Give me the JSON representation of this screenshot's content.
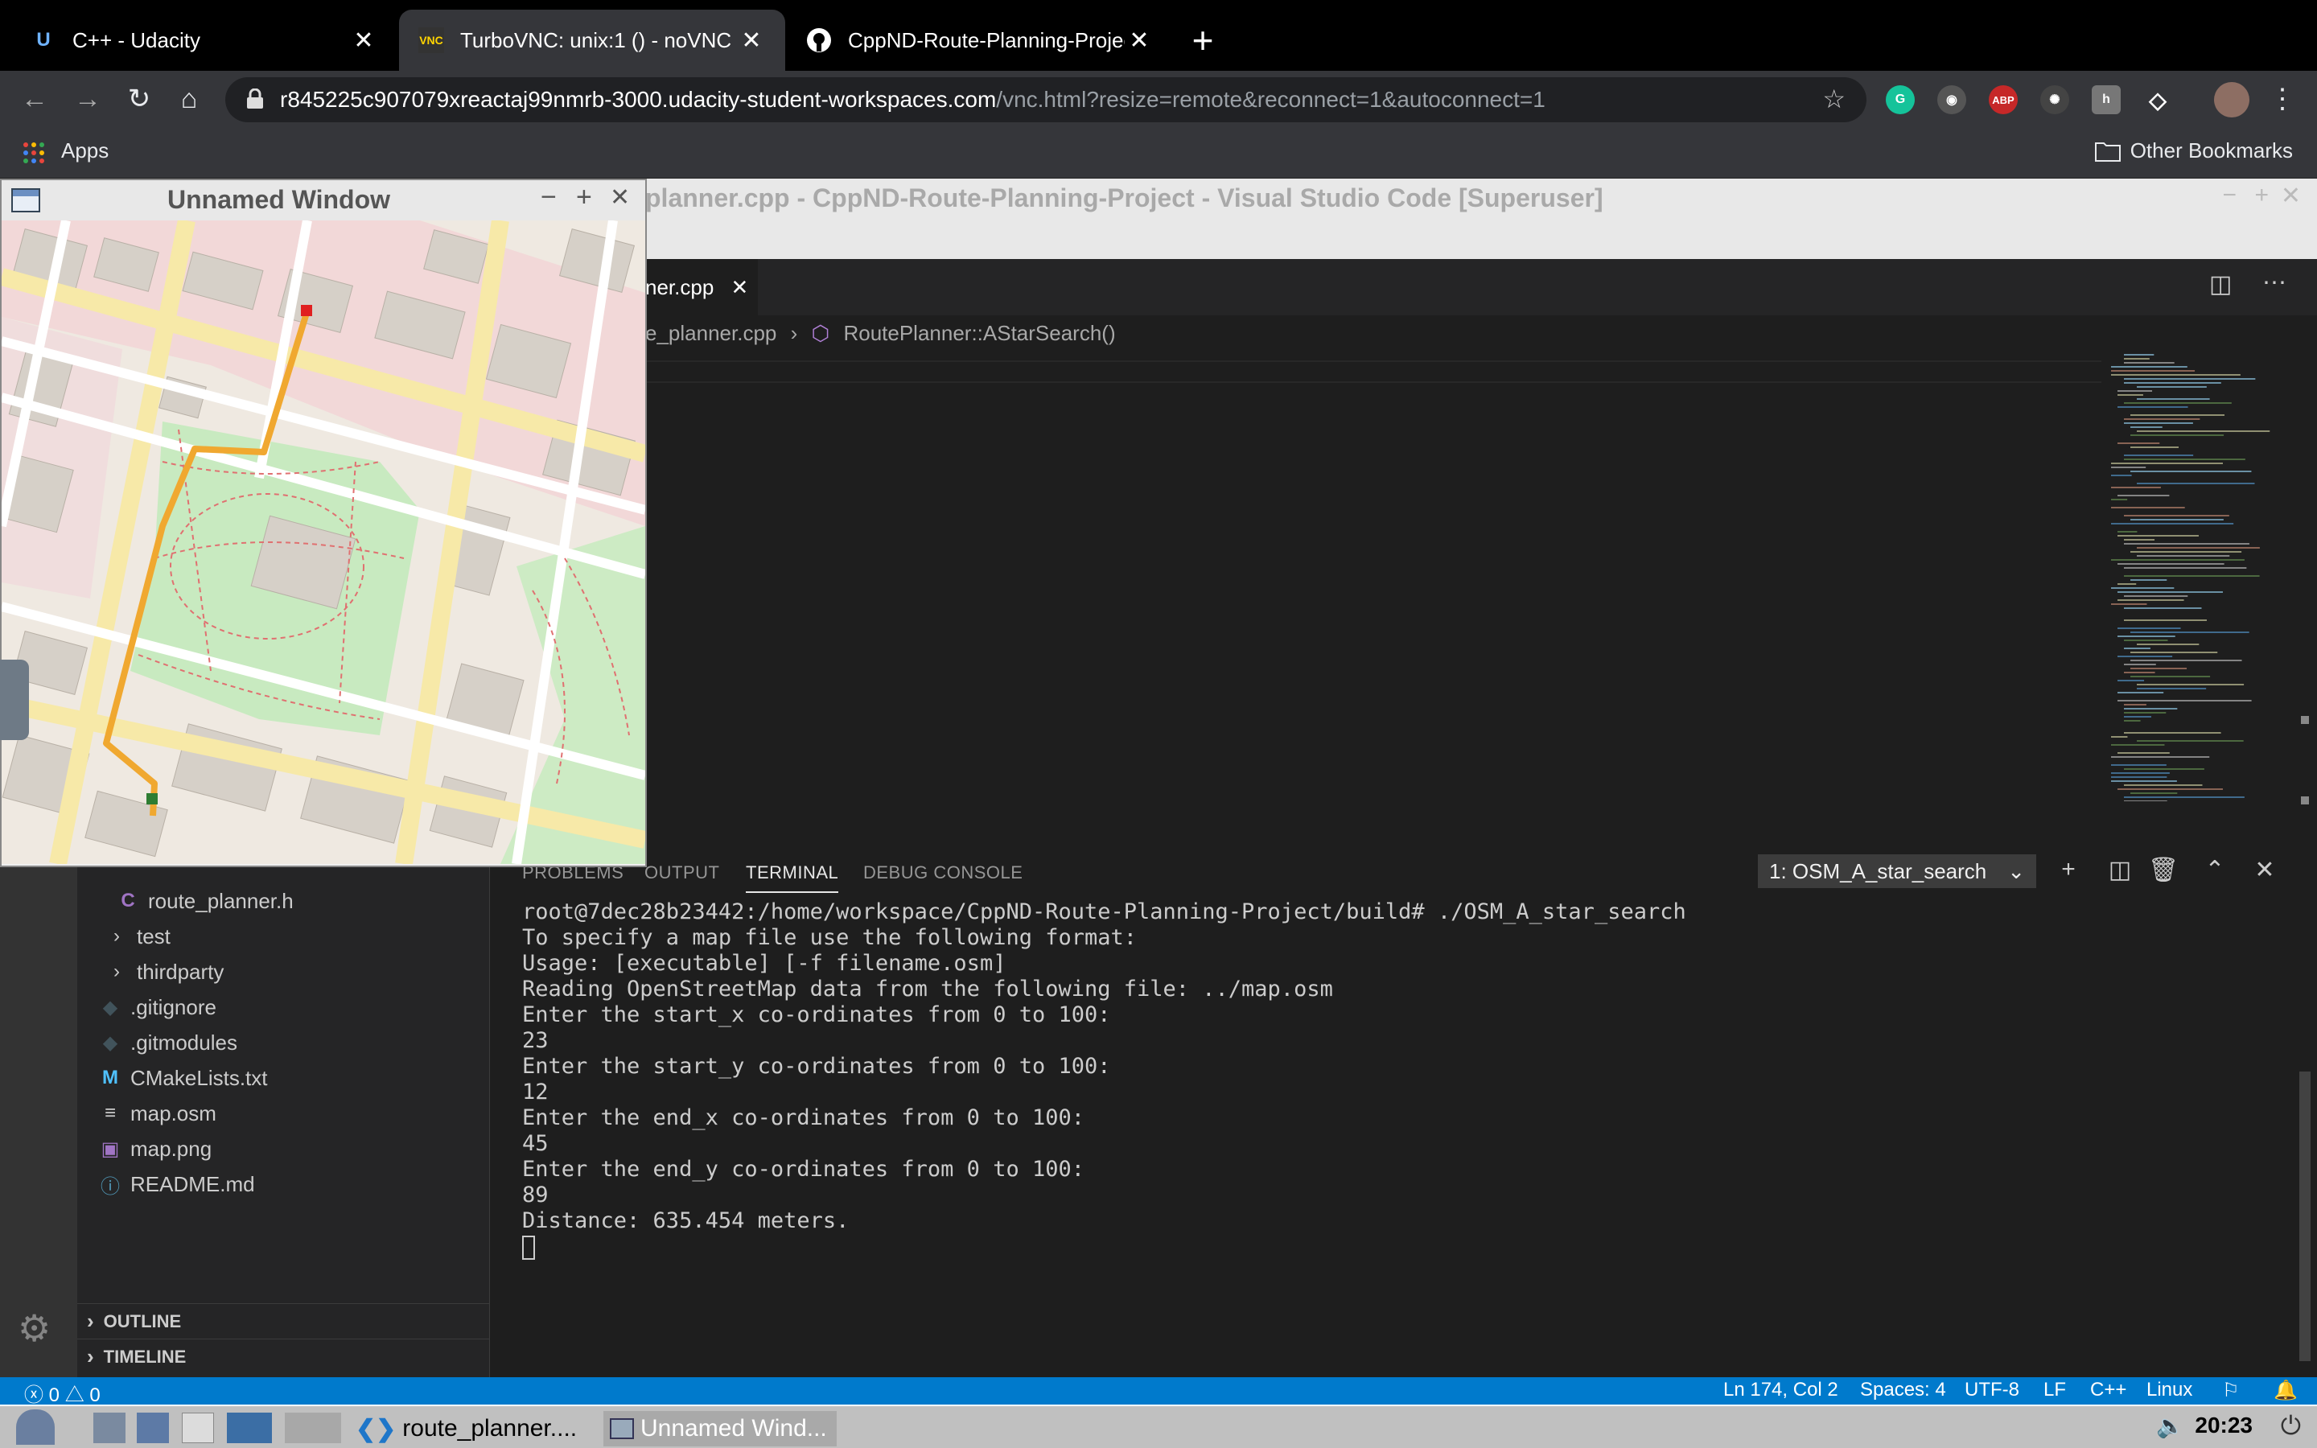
{
  "browser": {
    "tabs": [
      {
        "title": "C++ - Udacity",
        "icon": "udacity-icon",
        "close": "✕"
      },
      {
        "title": "TurboVNC: unix:1 () - noVNC",
        "icon": "vnc-icon",
        "close": "✕"
      },
      {
        "title": "CppND-Route-Planning-Projec",
        "icon": "github-icon",
        "close": "✕"
      }
    ],
    "new_tab": "+",
    "url_host": "r845225c907079xreactaj99nmrb-3000.udacity-student-workspaces.com",
    "url_rest": "/vnc.html?resize=remote&reconnect=1&autoconnect=1",
    "bookmarks": {
      "apps": "Apps",
      "other": "Other Bookmarks"
    },
    "ext_abp": "ABP"
  },
  "vscode": {
    "title": "planner.cpp - CppND-Route-Planning-Project - Visual Studio Code [Superuser]",
    "editor_tab": "ner.cpp",
    "editor_tab_close": "✕",
    "breadcrumb_file": "e_planner.cpp",
    "breadcrumb_sep": "›",
    "breadcrumb_symbol": "RoutePlanner::AStarSearch()",
    "explorer": {
      "items": [
        {
          "label": "route_planner.h",
          "icon": "C",
          "kind": "c-header"
        },
        {
          "label": "test",
          "icon": "›",
          "kind": "folder"
        },
        {
          "label": "thirdparty",
          "icon": "›",
          "kind": "folder"
        },
        {
          "label": ".gitignore",
          "icon": "◆",
          "kind": "git"
        },
        {
          "label": ".gitmodules",
          "icon": "◆",
          "kind": "git"
        },
        {
          "label": "CMakeLists.txt",
          "icon": "M",
          "kind": "cmake"
        },
        {
          "label": "map.osm",
          "icon": "≡",
          "kind": "text"
        },
        {
          "label": "map.png",
          "icon": "▣",
          "kind": "image"
        },
        {
          "label": "README.md",
          "icon": "ⓘ",
          "kind": "markdown"
        }
      ],
      "outline": "OUTLINE",
      "timeline": "TIMELINE"
    },
    "panel": {
      "tabs": [
        "PROBLEMS",
        "OUTPUT",
        "TERMINAL",
        "DEBUG CONSOLE"
      ],
      "active_tab": "TERMINAL",
      "terminal_select": "1: OSM_A_star_search",
      "terminal_lines": [
        "root@7dec28b23442:/home/workspace/CppND-Route-Planning-Project/build# ./OSM_A_star_search",
        "To specify a map file use the following format:",
        "Usage: [executable] [-f filename.osm]",
        "Reading OpenStreetMap data from the following file: ../map.osm",
        "Enter the start_x co-ordinates from 0 to 100:",
        "23",
        "Enter the start_y co-ordinates from 0 to 100:",
        "12",
        "Enter the end_x co-ordinates from 0 to 100:",
        "45",
        "Enter the end_y co-ordinates from 0 to 100:",
        "89",
        "Distance: 635.454 meters."
      ]
    },
    "status": {
      "errors": "0",
      "warnings": "0",
      "position": "Ln 174, Col 2",
      "spaces": "Spaces: 4",
      "encoding": "UTF-8",
      "eol": "LF",
      "language": "C++",
      "platform": "Linux"
    }
  },
  "map_window": {
    "title": "Unnamed Window",
    "controls": [
      "−",
      "+",
      "✕"
    ]
  },
  "taskbar": {
    "apps": [
      {
        "label": "route_planner....",
        "icon": "vscode-icon"
      },
      {
        "label": "Unnamed Wind...",
        "icon": "window-icon"
      }
    ],
    "clock": "20:23"
  },
  "colors": {
    "accent": "#007acc",
    "route": "#f0a830",
    "start_marker": "#2e7d32",
    "end_marker": "#e02020"
  }
}
